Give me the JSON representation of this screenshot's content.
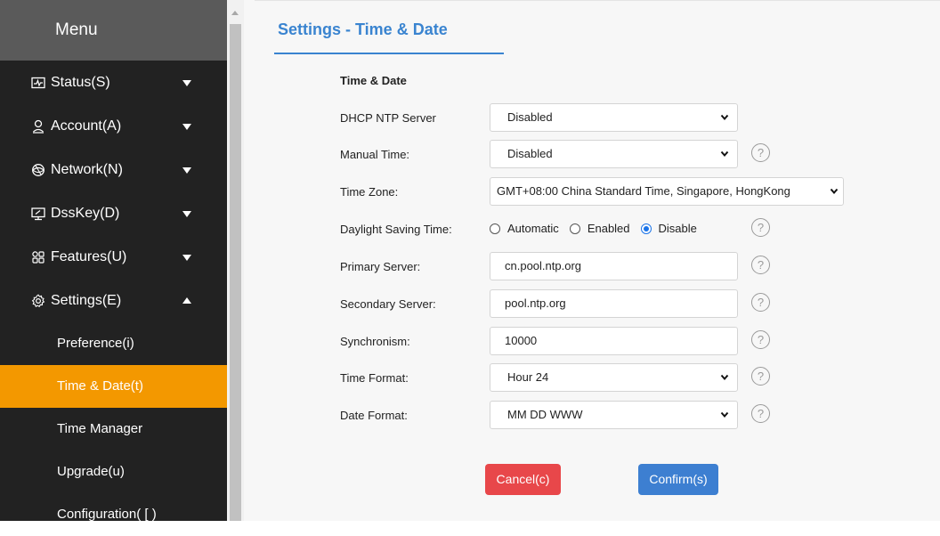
{
  "sidebar": {
    "title": "Menu",
    "items": [
      {
        "label": "Status(S)",
        "icon": "status-icon",
        "expanded": false
      },
      {
        "label": "Account(A)",
        "icon": "account-icon",
        "expanded": false
      },
      {
        "label": "Network(N)",
        "icon": "network-icon",
        "expanded": false
      },
      {
        "label": "DssKey(D)",
        "icon": "dsskey-icon",
        "expanded": false
      },
      {
        "label": "Features(U)",
        "icon": "features-icon",
        "expanded": false
      },
      {
        "label": "Settings(E)",
        "icon": "settings-icon",
        "expanded": true
      }
    ],
    "subitems": [
      {
        "label": "Preference(i)",
        "active": false
      },
      {
        "label": "Time & Date(t)",
        "active": true
      },
      {
        "label": "Time Manager",
        "active": false
      },
      {
        "label": "Upgrade(u)",
        "active": false
      },
      {
        "label": "Configuration( [ )",
        "active": false
      }
    ]
  },
  "page": {
    "title": "Settings - Time & Date",
    "section_title": "Time & Date"
  },
  "form": {
    "dhcp_ntp": {
      "label": "DHCP NTP Server",
      "value": "Disabled"
    },
    "manual_time": {
      "label": "Manual Time:",
      "value": "Disabled"
    },
    "time_zone": {
      "label": "Time Zone:",
      "value": "GMT+08:00 China Standard Time, Singapore, HongKong"
    },
    "dst": {
      "label": "Daylight Saving Time:",
      "options": [
        "Automatic",
        "Enabled",
        "Disable"
      ],
      "selected": "Disable"
    },
    "primary_server": {
      "label": "Primary Server:",
      "value": "cn.pool.ntp.org"
    },
    "secondary_server": {
      "label": "Secondary Server:",
      "value": "pool.ntp.org"
    },
    "synchronism": {
      "label": "Synchronism:",
      "value": "10000"
    },
    "time_format": {
      "label": "Time Format:",
      "value": "Hour 24"
    },
    "date_format": {
      "label": "Date Format:",
      "value": "MM DD WWW"
    },
    "help_glyph": "?"
  },
  "buttons": {
    "cancel": "Cancel(c)",
    "confirm": "Confirm(s)"
  },
  "colors": {
    "accent_blue": "#3a84d0",
    "active_orange": "#f39800",
    "cancel_red": "#e8474a",
    "confirm_blue": "#3d7fd1",
    "sidebar_bg": "#222222"
  }
}
